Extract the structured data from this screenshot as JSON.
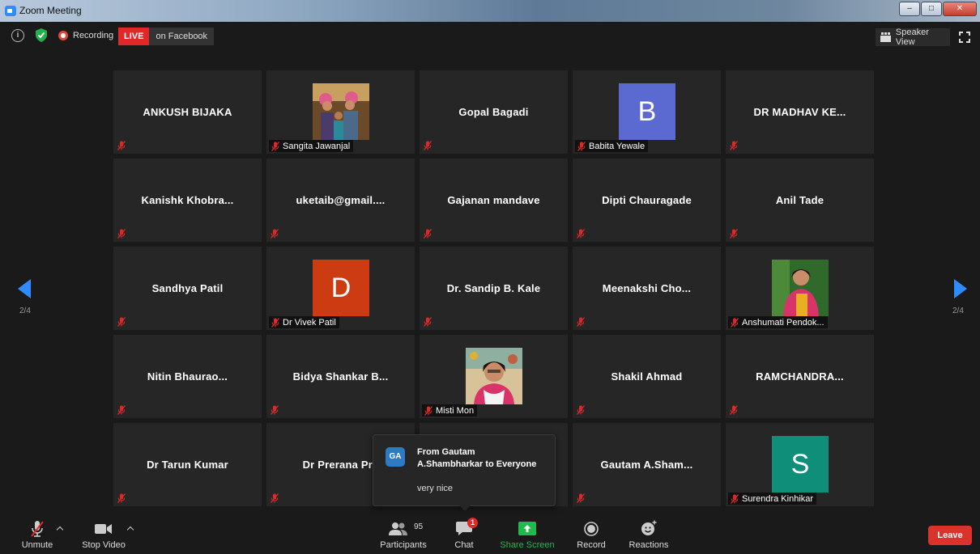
{
  "window": {
    "title": "Zoom Meeting",
    "minimize": "–",
    "maximize": "□",
    "close": "✕"
  },
  "topbar": {
    "recording_label": "Recording",
    "live_label": "LIVE",
    "live_destination": "on Facebook",
    "speaker_view_label": "Speaker View"
  },
  "pagination": {
    "left": "2/4",
    "right": "2/4"
  },
  "tiles": [
    {
      "name": "ANKUSH BIJAKA",
      "label": "",
      "avatar": ""
    },
    {
      "name": "",
      "label": "Sangita Jawanjal",
      "avatar": "photo-group"
    },
    {
      "name": "Gopal Bagadi",
      "label": "",
      "avatar": ""
    },
    {
      "name": "",
      "label": "Babita Yewale",
      "avatar": "B",
      "avatar_color": "#5b6ad0"
    },
    {
      "name": "DR MADHAV KE...",
      "label": "",
      "avatar": ""
    },
    {
      "name": "Kanishk  Khobra...",
      "label": "",
      "avatar": ""
    },
    {
      "name": "uketaib@gmail....",
      "label": "",
      "avatar": ""
    },
    {
      "name": "Gajanan mandave",
      "label": "",
      "avatar": ""
    },
    {
      "name": "Dipti Chauragade",
      "label": "",
      "avatar": ""
    },
    {
      "name": "Anil Tade",
      "label": "",
      "avatar": ""
    },
    {
      "name": "Sandhya Patil",
      "label": "",
      "avatar": ""
    },
    {
      "name": "",
      "label": "Dr Vivek Patil",
      "avatar": "D",
      "avatar_color": "#cc3b11"
    },
    {
      "name": "Dr. Sandip B. Kale",
      "label": "",
      "avatar": ""
    },
    {
      "name": "Meenakshi  Cho...",
      "label": "",
      "avatar": ""
    },
    {
      "name": "",
      "label": "Anshumati Pendok...",
      "avatar": "photo-woman"
    },
    {
      "name": "Nitin  Bhaurao...",
      "label": "",
      "avatar": ""
    },
    {
      "name": "Bidya  Shankar  B...",
      "label": "",
      "avatar": ""
    },
    {
      "name": "",
      "label": "Misti Mon",
      "avatar": "photo-girl"
    },
    {
      "name": "Shakil Ahmad",
      "label": "",
      "avatar": ""
    },
    {
      "name": "RAMCHANDRA...",
      "label": "",
      "avatar": ""
    },
    {
      "name": "Dr Tarun Kumar",
      "label": "",
      "avatar": ""
    },
    {
      "name": "Dr Prerana Pra",
      "label": "",
      "avatar": ""
    },
    {
      "name": "",
      "label": "",
      "avatar": ""
    },
    {
      "name": "Gautam  A.Sham...",
      "label": "",
      "avatar": ""
    },
    {
      "name": "",
      "label": "Surendra Kinhikar",
      "avatar": "S",
      "avatar_color": "#0f8f7a"
    }
  ],
  "chat_popup": {
    "avatar_initials": "GA",
    "from_line1": "From Gautam",
    "from_line2": "A.Shambharkar to Everyone",
    "message": "very nice"
  },
  "toolbar": {
    "unmute": "Unmute",
    "stop_video": "Stop Video",
    "participants": "Participants",
    "participants_count": "95",
    "chat": "Chat",
    "chat_badge": "1",
    "share_screen": "Share Screen",
    "record": "Record",
    "reactions": "Reactions",
    "leave": "Leave"
  },
  "colors": {
    "share_green": "#1fb94f",
    "live_red": "#e02828",
    "leave_red": "#d9332c",
    "nav_blue": "#2d8cff"
  }
}
